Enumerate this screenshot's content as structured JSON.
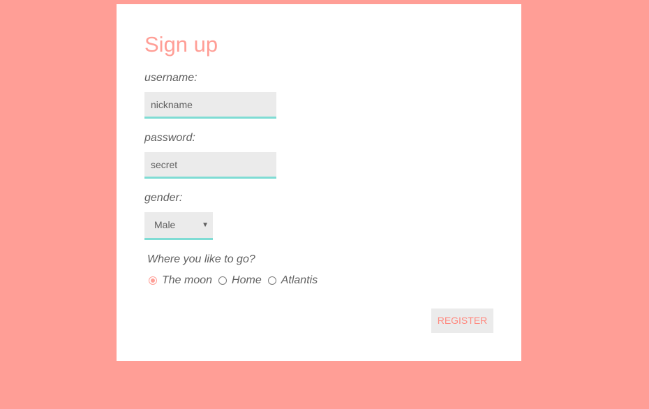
{
  "form": {
    "title": "Sign up",
    "username": {
      "label": "username:",
      "value": "nickname"
    },
    "password": {
      "label": "password:",
      "value": "secret"
    },
    "gender": {
      "label": "gender:",
      "selected": "Male"
    },
    "destination": {
      "question": "Where you like to go?",
      "options": [
        {
          "label": "The moon",
          "checked": true
        },
        {
          "label": "Home",
          "checked": false
        },
        {
          "label": "Atlantis",
          "checked": false
        }
      ]
    },
    "register_label": "REGISTER"
  },
  "colors": {
    "background": "#ff9e96",
    "accent": "#7fdcd4",
    "field": "#ebebeb",
    "text": "#606060"
  },
  "icons": {
    "select_arrow": "dropdown-arrow-icon"
  }
}
